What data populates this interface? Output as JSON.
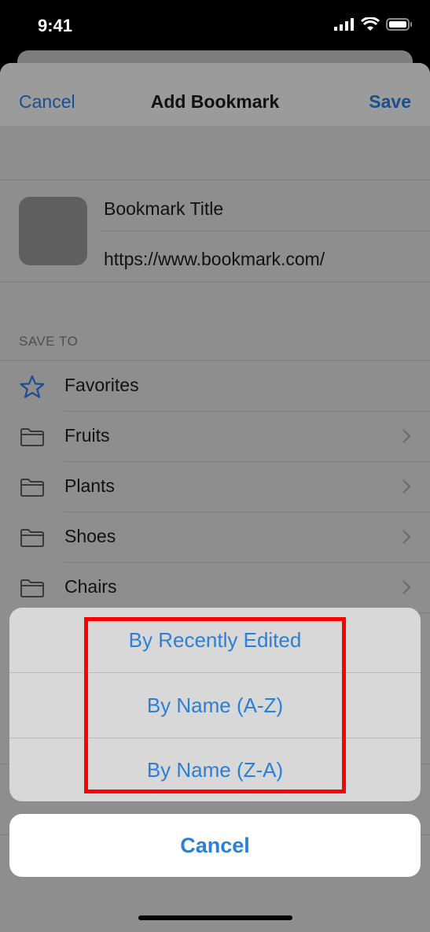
{
  "status_bar": {
    "time": "9:41"
  },
  "navbar": {
    "cancel_label": "Cancel",
    "title": "Add Bookmark",
    "save_label": "Save"
  },
  "bookmark": {
    "title": "Bookmark Title",
    "url": "https://www.bookmark.com/"
  },
  "save_to": {
    "header": "SAVE TO",
    "items": [
      {
        "label": "Favorites",
        "icon": "star-icon"
      },
      {
        "label": "Fruits",
        "icon": "folder-icon"
      },
      {
        "label": "Plants",
        "icon": "folder-icon"
      },
      {
        "label": "Shoes",
        "icon": "folder-icon"
      },
      {
        "label": "Chairs",
        "icon": "folder-icon"
      }
    ]
  },
  "action_sheet": {
    "options": [
      "By Recently Edited",
      "By Name (A-Z)",
      "By Name (Z-A)"
    ],
    "cancel_label": "Cancel"
  },
  "colors": {
    "accent": "#2b7fd6",
    "highlight": "#ff0000"
  }
}
